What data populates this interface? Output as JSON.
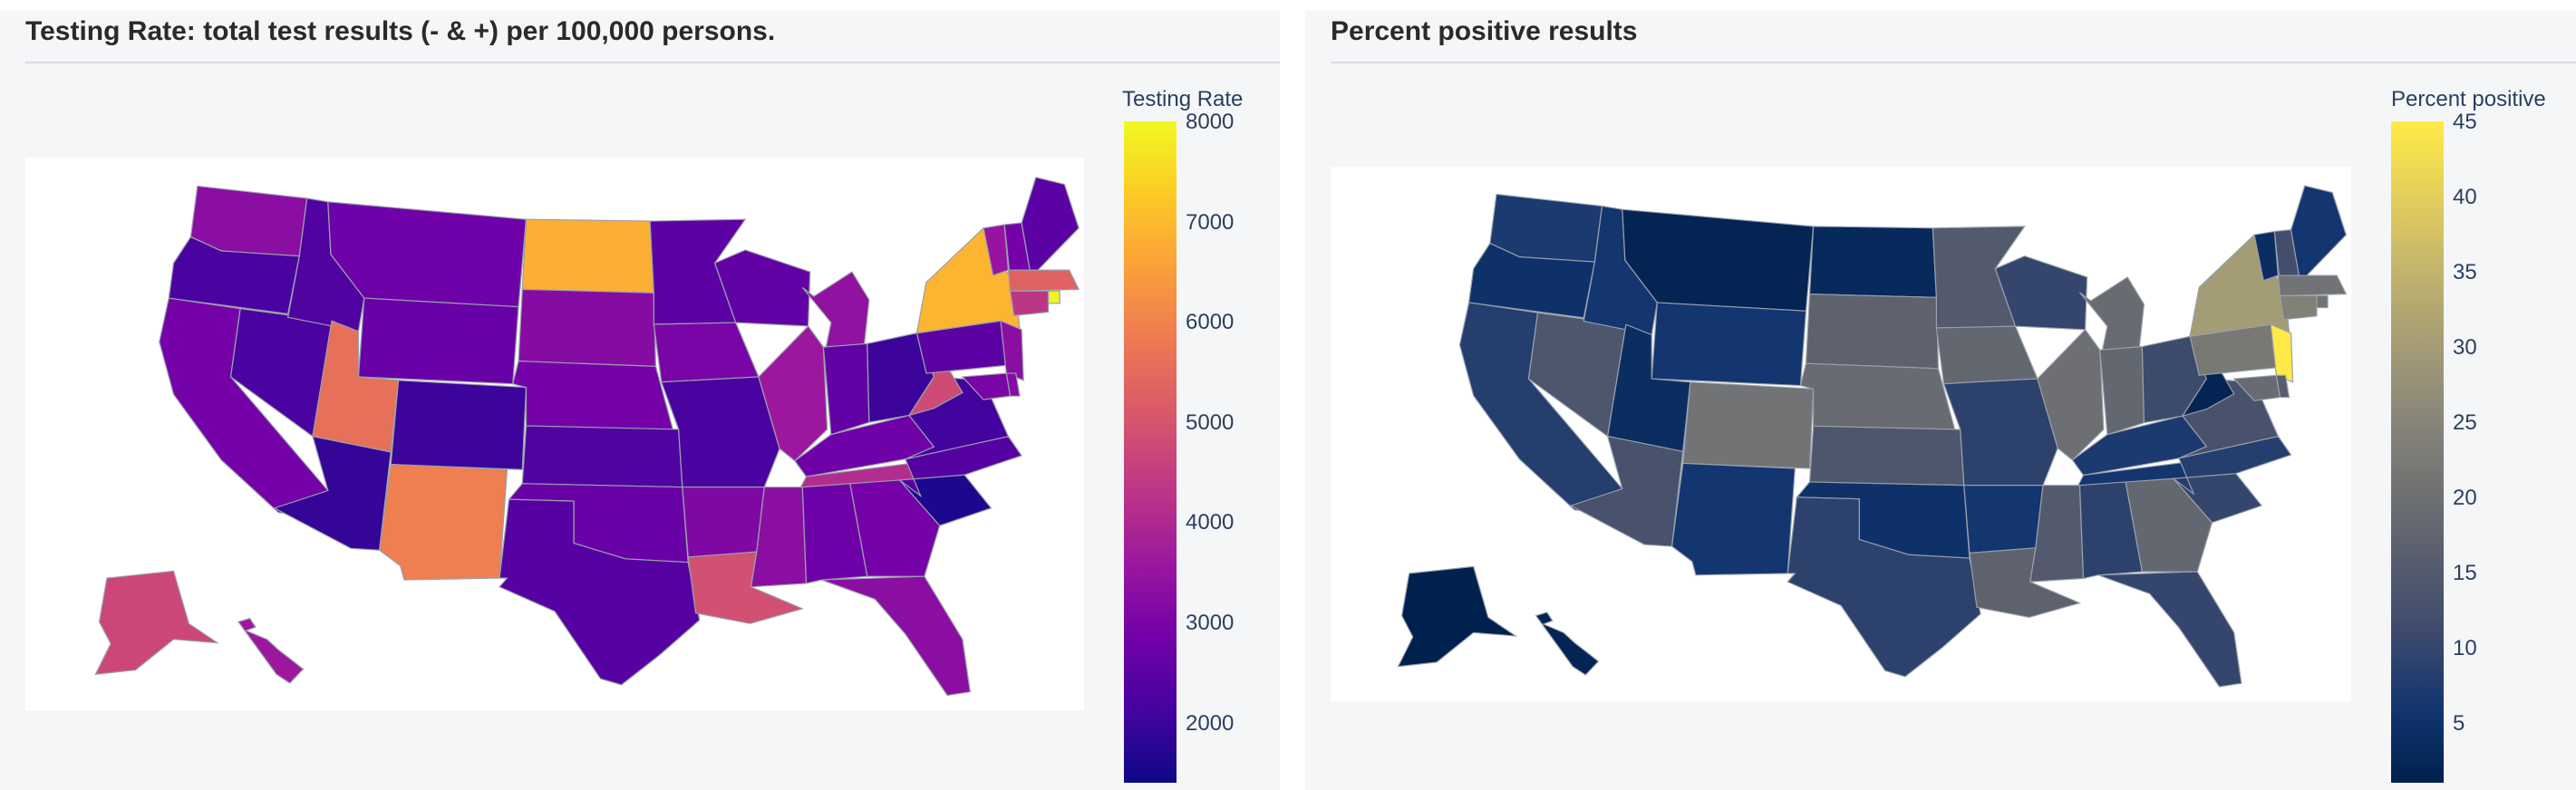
{
  "chart_data": [
    {
      "type": "choropleth",
      "title": "Testing Rate: total test results (- & +) per 100,000 persons.",
      "colorbar": {
        "title": "Testing Rate",
        "range": [
          1400,
          8000
        ],
        "ticks": [
          2000,
          3000,
          4000,
          5000,
          6000,
          7000,
          8000
        ],
        "tick_labels": [
          "2000",
          "3000",
          "4000",
          "5000",
          "6000",
          "7000",
          "8000"
        ],
        "colorscale": [
          "#0d0887",
          "#46039f",
          "#7201a8",
          "#9c179e",
          "#bd3786",
          "#d8576b",
          "#ed7953",
          "#fb9f3a",
          "#fdca26",
          "#f0f921"
        ]
      },
      "states": [
        {
          "state": "WA",
          "value": 3300
        },
        {
          "state": "OR",
          "value": 2200
        },
        {
          "state": "CA",
          "value": 2900
        },
        {
          "state": "NV",
          "value": 2200
        },
        {
          "state": "ID",
          "value": 2300
        },
        {
          "state": "MT",
          "value": 2800
        },
        {
          "state": "WY",
          "value": 2700
        },
        {
          "state": "UT",
          "value": 5600
        },
        {
          "state": "AZ",
          "value": 1900
        },
        {
          "state": "CO",
          "value": 2000
        },
        {
          "state": "NM",
          "value": 5900
        },
        {
          "state": "ND",
          "value": 6800
        },
        {
          "state": "SD",
          "value": 3200
        },
        {
          "state": "NE",
          "value": 2900
        },
        {
          "state": "KS",
          "value": 2300
        },
        {
          "state": "OK",
          "value": 2700
        },
        {
          "state": "TX",
          "value": 2400
        },
        {
          "state": "MN",
          "value": 2500
        },
        {
          "state": "IA",
          "value": 3000
        },
        {
          "state": "MO",
          "value": 2200
        },
        {
          "state": "AR",
          "value": 3100
        },
        {
          "state": "LA",
          "value": 4900
        },
        {
          "state": "WI",
          "value": 2600
        },
        {
          "state": "IL",
          "value": 3600
        },
        {
          "state": "MI",
          "value": 3400
        },
        {
          "state": "IN",
          "value": 2600
        },
        {
          "state": "OH",
          "value": 2000
        },
        {
          "state": "KY",
          "value": 2800
        },
        {
          "state": "TN",
          "value": 4100
        },
        {
          "state": "MS",
          "value": 3300
        },
        {
          "state": "AL",
          "value": 2800
        },
        {
          "state": "GA",
          "value": 2900
        },
        {
          "state": "FL",
          "value": 3300
        },
        {
          "state": "SC",
          "value": 1600
        },
        {
          "state": "NC",
          "value": 2400
        },
        {
          "state": "VA",
          "value": 2100
        },
        {
          "state": "WV",
          "value": 4800
        },
        {
          "state": "PA",
          "value": 2500
        },
        {
          "state": "NY",
          "value": 6900
        },
        {
          "state": "VT",
          "value": 3500
        },
        {
          "state": "NH",
          "value": 2900
        },
        {
          "state": "ME",
          "value": 2500
        },
        {
          "state": "MA",
          "value": 5300
        },
        {
          "state": "RI",
          "value": 7900
        },
        {
          "state": "CT",
          "value": 4300
        },
        {
          "state": "NJ",
          "value": 3300
        },
        {
          "state": "DE",
          "value": 3200
        },
        {
          "state": "MD",
          "value": 3000
        },
        {
          "state": "AK",
          "value": 4700
        },
        {
          "state": "HI",
          "value": 3600
        }
      ]
    },
    {
      "type": "choropleth",
      "title": "Percent positive results",
      "colorbar": {
        "title": "Percent positive",
        "range": [
          1,
          45
        ],
        "ticks": [
          5,
          10,
          15,
          20,
          25,
          30,
          35,
          40,
          45
        ],
        "tick_labels": [
          "5",
          "10",
          "15",
          "20",
          "25",
          "30",
          "35",
          "40",
          "45"
        ],
        "colorscale": [
          "#00204d",
          "#123570",
          "#3b496c",
          "#575d6d",
          "#707173",
          "#8a8779",
          "#a69d75",
          "#c4b56c",
          "#e4cf5b",
          "#ffea46"
        ]
      },
      "states": [
        {
          "state": "WA",
          "value": 7
        },
        {
          "state": "OR",
          "value": 5
        },
        {
          "state": "CA",
          "value": 8
        },
        {
          "state": "NV",
          "value": 14
        },
        {
          "state": "ID",
          "value": 6
        },
        {
          "state": "MT",
          "value": 2
        },
        {
          "state": "WY",
          "value": 6
        },
        {
          "state": "UT",
          "value": 4
        },
        {
          "state": "AZ",
          "value": 13
        },
        {
          "state": "CO",
          "value": 21
        },
        {
          "state": "NM",
          "value": 6
        },
        {
          "state": "ND",
          "value": 3
        },
        {
          "state": "SD",
          "value": 17
        },
        {
          "state": "NE",
          "value": 19
        },
        {
          "state": "KS",
          "value": 14
        },
        {
          "state": "OK",
          "value": 5
        },
        {
          "state": "TX",
          "value": 9
        },
        {
          "state": "MN",
          "value": 15
        },
        {
          "state": "IA",
          "value": 18
        },
        {
          "state": "MO",
          "value": 9
        },
        {
          "state": "AR",
          "value": 6
        },
        {
          "state": "LA",
          "value": 17
        },
        {
          "state": "WI",
          "value": 10
        },
        {
          "state": "IL",
          "value": 20
        },
        {
          "state": "MI",
          "value": 19
        },
        {
          "state": "IN",
          "value": 18
        },
        {
          "state": "OH",
          "value": 11
        },
        {
          "state": "KY",
          "value": 7
        },
        {
          "state": "TN",
          "value": 6
        },
        {
          "state": "MS",
          "value": 15
        },
        {
          "state": "AL",
          "value": 9
        },
        {
          "state": "GA",
          "value": 18
        },
        {
          "state": "FL",
          "value": 10
        },
        {
          "state": "SC",
          "value": 10
        },
        {
          "state": "NC",
          "value": 8
        },
        {
          "state": "VA",
          "value": 13
        },
        {
          "state": "WV",
          "value": 2
        },
        {
          "state": "PA",
          "value": 22
        },
        {
          "state": "NY",
          "value": 30
        },
        {
          "state": "VT",
          "value": 4
        },
        {
          "state": "NH",
          "value": 12
        },
        {
          "state": "ME",
          "value": 6
        },
        {
          "state": "MA",
          "value": 21
        },
        {
          "state": "RI",
          "value": 21
        },
        {
          "state": "CT",
          "value": 24
        },
        {
          "state": "NJ",
          "value": 45
        },
        {
          "state": "DE",
          "value": 16
        },
        {
          "state": "MD",
          "value": 19
        },
        {
          "state": "AK",
          "value": 1
        },
        {
          "state": "HI",
          "value": 2
        }
      ]
    }
  ]
}
